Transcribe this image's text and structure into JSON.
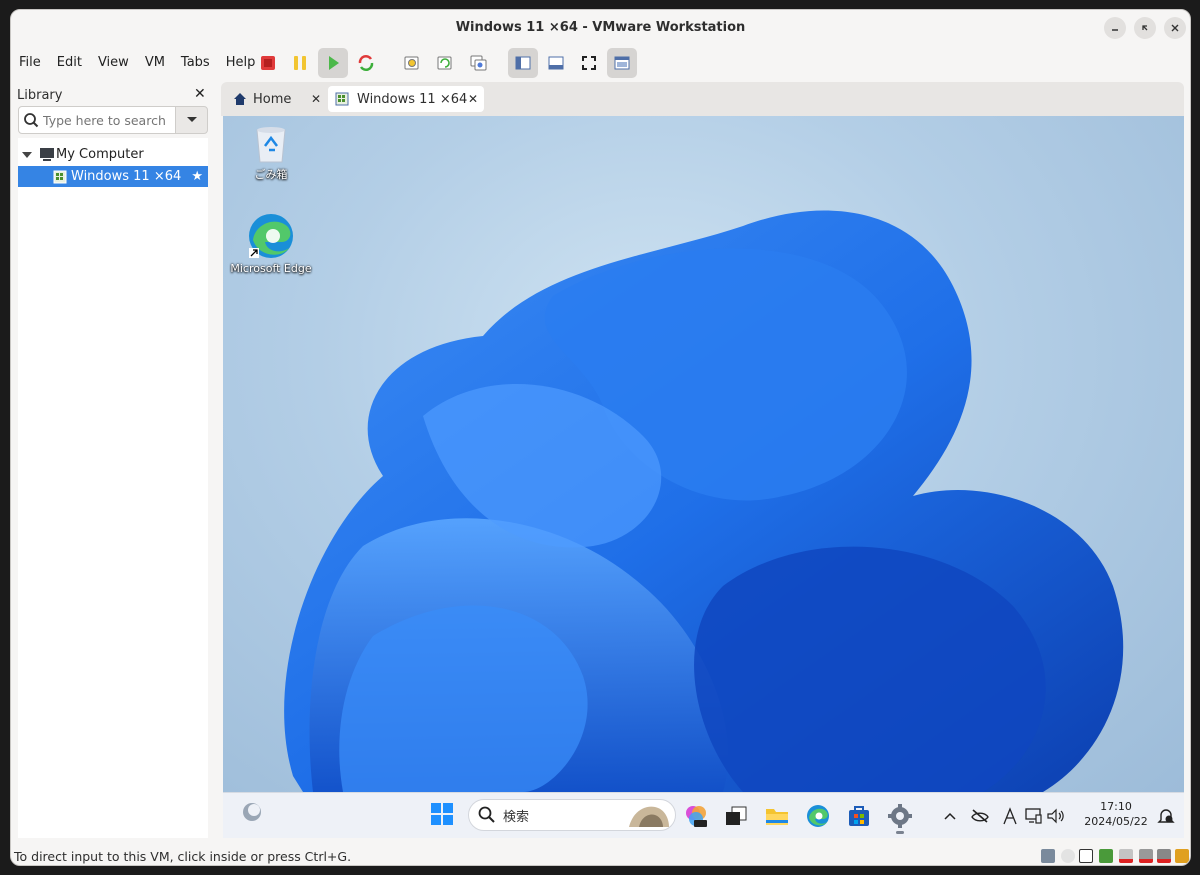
{
  "window": {
    "title": "Windows 11 ×64 - VMware Workstation"
  },
  "menubar": {
    "items": [
      "File",
      "Edit",
      "View",
      "VM",
      "Tabs",
      "Help"
    ]
  },
  "toolbar": {
    "icons": [
      "power-off-icon",
      "suspend-icon",
      "power-on-icon",
      "restart-icon",
      "snapshot-icon",
      "revert-snapshot-icon",
      "manage-snapshots-icon",
      "show-library-icon",
      "thumbnail-bar-icon",
      "fullscreen-icon",
      "console-view-icon"
    ]
  },
  "library": {
    "title": "Library",
    "search_placeholder": "Type here to search",
    "tree": [
      {
        "label": "My Computer",
        "expanded": true
      },
      {
        "label": "Windows 11 ×64",
        "selected": true
      }
    ]
  },
  "tabs": [
    {
      "label": "Home"
    },
    {
      "label": "Windows 11 ×64",
      "active": true
    }
  ],
  "guest": {
    "desktop_icons": [
      {
        "label": "ごみ箱",
        "icon": "recycle-bin-icon"
      },
      {
        "label": "Microsoft Edge",
        "icon": "edge-icon"
      }
    ],
    "taskbar": {
      "search_label": "検索",
      "time": "17:10",
      "date": "2024/05/22"
    }
  },
  "statusbar": {
    "text": "To direct input to this VM, click inside or press Ctrl+G."
  },
  "colors": {
    "selection": "#3584e4",
    "desktop_accent": "#1f6fe8"
  }
}
